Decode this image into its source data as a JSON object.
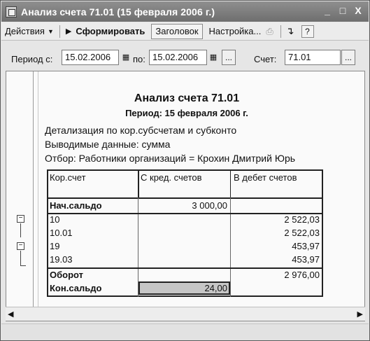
{
  "window": {
    "title": "Анализ счета 71.01 (15 февраля 2006 г.)",
    "minimize": "_",
    "maximize": "□",
    "close": "X"
  },
  "toolbar": {
    "actions": "Действия",
    "generate": "Сформировать",
    "header": "Заголовок",
    "settings": "Настройка...",
    "help": "?"
  },
  "filter": {
    "period_from_label": "Период с:",
    "period_from_value": "15.02.2006",
    "period_to_label": "по:",
    "period_to_value": "15.02.2006",
    "account_label": "Счет:",
    "account_value": "71.01",
    "dots": "..."
  },
  "report": {
    "title": "Анализ счета 71.01",
    "period": "Период: 15 февраля 2006 г.",
    "detail": "Детализация по  кор.субсчетам и субконто",
    "output": "Выводимые данные: сумма",
    "selection": "Отбор: Работники организаций = Крохин Дмитрий Юрь",
    "columns": [
      "Кор.счет",
      "С кред. счетов",
      "В дебет счетов"
    ],
    "open_balance": {
      "label": "Нач.сальдо",
      "credit": "3 000,00",
      "debit": ""
    },
    "rows": [
      {
        "account": "10",
        "credit": "",
        "debit": "2 522,03"
      },
      {
        "account": "10.01",
        "credit": "",
        "debit": "2 522,03"
      },
      {
        "account": "19",
        "credit": "",
        "debit": "453,97"
      },
      {
        "account": "19.03",
        "credit": "",
        "debit": "453,97"
      }
    ],
    "turnover": {
      "label": "Оборот",
      "credit": "",
      "debit": "2 976,00"
    },
    "close_balance": {
      "label": "Кон.сальдо",
      "credit": "24,00",
      "debit": ""
    }
  }
}
